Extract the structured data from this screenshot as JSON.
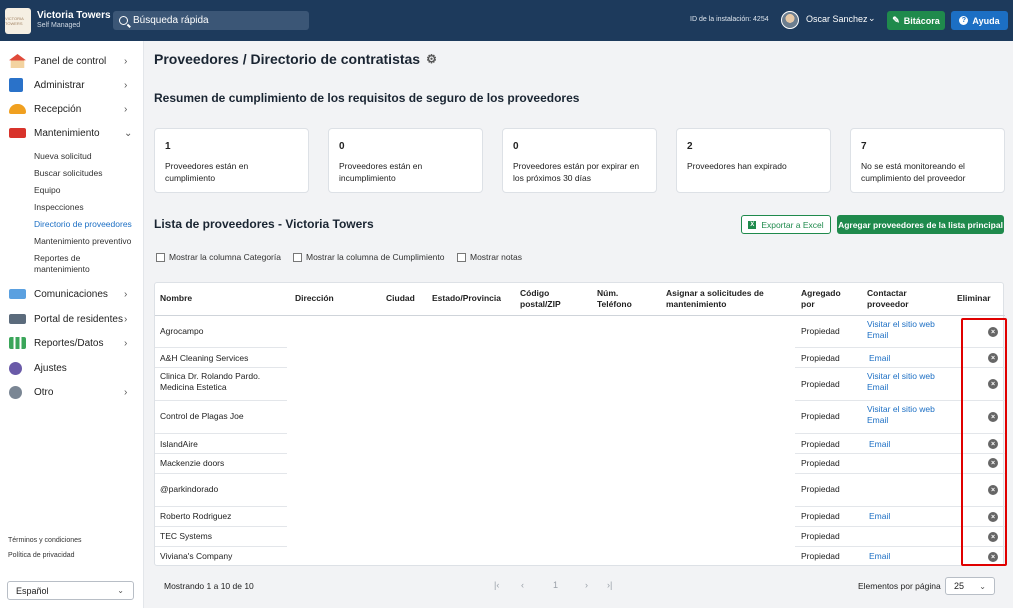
{
  "app": {
    "logo_text": "VICTORIA TOWERS",
    "name": "Victoria Towers",
    "subtitle": "Self Managed"
  },
  "topbar": {
    "search_placeholder": "Búsqueda rápida",
    "install_id": "ID de la instalación: 4254",
    "user_name": "Oscar Sanchez",
    "bitacora_label": "Bitácora",
    "ayuda_label": "Ayuda"
  },
  "sidebar": {
    "items": [
      {
        "label": "Panel de control",
        "icon": "house-icon",
        "chev": "›"
      },
      {
        "label": "Administrar",
        "icon": "building-icon",
        "chev": "›"
      },
      {
        "label": "Recepción",
        "icon": "bell-icon",
        "chev": "›"
      },
      {
        "label": "Mantenimiento",
        "icon": "toolbox-icon",
        "chev": "⌄"
      },
      {
        "label": "Comunicaciones",
        "icon": "mail-icon",
        "chev": "›"
      },
      {
        "label": "Portal de residentes",
        "icon": "laptop-icon",
        "chev": "›"
      },
      {
        "label": "Reportes/Datos",
        "icon": "chart-icon",
        "chev": "›"
      },
      {
        "label": "Ajustes",
        "icon": "gear-icon",
        "chev": ""
      },
      {
        "label": "Otro",
        "icon": "more-icon",
        "chev": "›"
      }
    ],
    "sub_items": [
      "Nueva solicitud",
      "Buscar solicitudes",
      "Equipo",
      "Inspecciones",
      "Directorio de proveedores",
      "Mantenimiento preventivo",
      "Reportes de mantenimiento"
    ],
    "terms": "Términos y condiciones",
    "privacy": "Política de privacidad",
    "language": "Español"
  },
  "main": {
    "page_title": "Proveedores / Directorio de contratistas",
    "summary_title": "Resumen de cumplimiento de los requisitos de seguro de los proveedores",
    "cards": [
      {
        "num": "1",
        "desc": "Proveedores están en cumplimiento"
      },
      {
        "num": "0",
        "desc": "Proveedores están en incumplimiento"
      },
      {
        "num": "0",
        "desc": "Proveedores están por expirar en los próximos 30 días"
      },
      {
        "num": "2",
        "desc": "Proveedores han expirado"
      },
      {
        "num": "7",
        "desc": "No se está monitoreando el cumplimiento del proveedor"
      }
    ],
    "list_title": "Lista de proveedores - Victoria Towers",
    "export_label": "Exportar a Excel",
    "add_label": "Agregar proveedores de la lista principal",
    "checkboxes": [
      "Mostrar la columna Categoría",
      "Mostrar la columna de Cumplimiento",
      "Mostrar notas"
    ],
    "columns": [
      "Nombre",
      "Dirección",
      "Ciudad",
      "Estado/Provincia",
      "Código postal/ZIP",
      "Núm. Teléfono",
      "Asignar a solicitudes de mantenimiento",
      "Agregado por",
      "Contactar proveedor",
      "Eliminar"
    ],
    "rows": [
      {
        "name": "Agrocampo",
        "added_by": "Propiedad",
        "contact": "Visitar el sitio web  Email"
      },
      {
        "name": "A&H Cleaning Services",
        "added_by": "Propiedad",
        "contact": "Email"
      },
      {
        "name": "Clinica Dr. Rolando Pardo. Medicina Estetica",
        "added_by": "Propiedad",
        "contact": "Visitar el sitio web  Email"
      },
      {
        "name": "Control de Plagas Joe",
        "added_by": "Propiedad",
        "contact": "Visitar el sitio web  Email"
      },
      {
        "name": "IslandAire",
        "added_by": "Propiedad",
        "contact": "Email"
      },
      {
        "name": "Mackenzie doors",
        "added_by": "Propiedad",
        "contact": ""
      },
      {
        "name": "@parkindorado",
        "added_by": "Propiedad",
        "contact": ""
      },
      {
        "name": "Roberto Rodriguez",
        "added_by": "Propiedad",
        "contact": "Email"
      },
      {
        "name": "TEC Systems",
        "added_by": "Propiedad",
        "contact": ""
      },
      {
        "name": "Viviana's Company",
        "added_by": "Propiedad",
        "contact": "Email"
      }
    ],
    "pagination": {
      "info": "Mostrando 1 a 10 de 10",
      "first": "|‹",
      "prev": "‹",
      "page": "1",
      "next": "›",
      "last": "›|",
      "per_page_label": "Elementos por página",
      "per_page_value": "25"
    }
  },
  "colors": {
    "topbar": "#1d3a5c",
    "primary_green": "#1f8a4c",
    "primary_blue": "#1c6fc4",
    "highlight_red": "#e00000"
  }
}
